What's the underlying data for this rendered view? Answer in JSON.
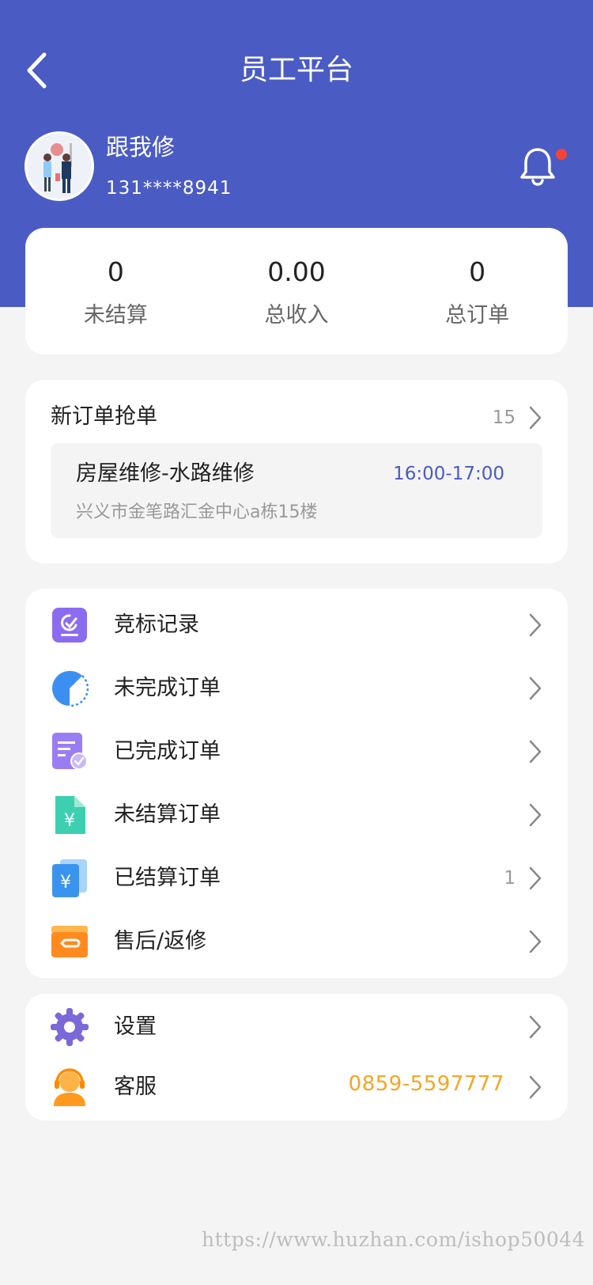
{
  "header": {
    "title": "员工平台",
    "back_icon": "chevron-left-icon",
    "bg_color": "#4a5bc4"
  },
  "user": {
    "name": "跟我修",
    "phone": "131****8941",
    "has_notification": true
  },
  "stats": [
    {
      "value": "0",
      "label": "未结算"
    },
    {
      "value": "0.00",
      "label": "总收入"
    },
    {
      "value": "0",
      "label": "总订单"
    }
  ],
  "new_orders": {
    "title": "新订单抢单",
    "count": "15",
    "order": {
      "name": "房屋维修-水路维修",
      "time": "16:00-17:00",
      "address": "兴义市金笔路汇金中心a栋15楼"
    }
  },
  "menu": {
    "items": [
      {
        "label": "竞标记录",
        "icon": "bid-record-icon"
      },
      {
        "label": "未完成订单",
        "icon": "pie-clock-icon"
      },
      {
        "label": "已完成订单",
        "icon": "document-check-icon"
      },
      {
        "label": "未结算订单",
        "icon": "yuan-document-icon"
      },
      {
        "label": "已结算订单",
        "icon": "yuan-stack-icon",
        "badge": "1"
      },
      {
        "label": "售后/返修",
        "icon": "return-box-icon"
      }
    ]
  },
  "settings": {
    "items": [
      {
        "label": "设置",
        "icon": "gear-icon"
      },
      {
        "label": "客服",
        "icon": "customer-service-icon",
        "phone": "0859-5597777"
      }
    ]
  },
  "watermark": "https://www.huzhan.com/ishop50044",
  "colors": {
    "accent": "#4a5bc4",
    "phone": "#f5a623",
    "notify_dot": "#f44336"
  }
}
